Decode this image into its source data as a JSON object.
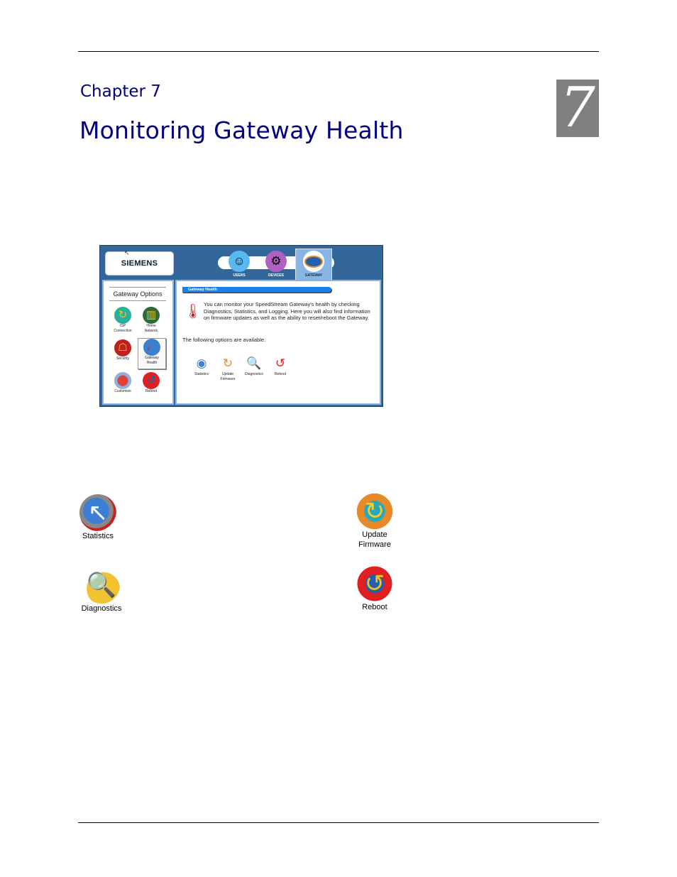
{
  "chapter": {
    "label": "Chapter 7",
    "title": "Monitoring Gateway Health",
    "number": "7"
  },
  "screenshot": {
    "logo": "SIEMENS",
    "nav_tabs": [
      {
        "label": "USERS",
        "icon": "users-icon",
        "active": false
      },
      {
        "label": "DEVICES",
        "icon": "devices-icon",
        "active": false
      },
      {
        "label": "GATEWAY",
        "icon": "gateway-icon",
        "active": true
      }
    ],
    "options_title": "Gateway Options",
    "options": [
      {
        "label_line1": "ISP",
        "label_line2": "Connection",
        "icon": "isp-connection-icon"
      },
      {
        "label_line1": "Home",
        "label_line2": "Network",
        "icon": "home-network-icon"
      },
      {
        "label_line1": "Security",
        "label_line2": "",
        "icon": "security-icon"
      },
      {
        "label_line1": "Gateway",
        "label_line2": "Health",
        "icon": "gateway-health-icon",
        "selected": true
      },
      {
        "label_line1": "Customize",
        "label_line2": "",
        "icon": "customize-icon"
      },
      {
        "label_line1": "Reboot",
        "label_line2": "",
        "icon": "reboot-icon"
      }
    ],
    "section_header": "Gateway Health",
    "description": "You can monitor your SpeedStream Gateway's health by checking Diagnostics, Statistics, and Logging. Here you will also find information on firmware updates as well as the ability to reset/reboot the Gateway.",
    "available_label": "The following options are available:",
    "available_options": [
      {
        "label_line1": "Statistics",
        "label_line2": ""
      },
      {
        "label_line1": "Update",
        "label_line2": "Firmware"
      },
      {
        "label_line1": "Diagnostics",
        "label_line2": ""
      },
      {
        "label_line1": "Reboot",
        "label_line2": ""
      }
    ]
  },
  "features": [
    {
      "label_line1": "Statistics",
      "label_line2": "",
      "icon": "statistics-icon"
    },
    {
      "label_line1": "Update",
      "label_line2": "Firmware",
      "icon": "update-firmware-icon"
    },
    {
      "label_line1": "Diagnostics",
      "label_line2": "",
      "icon": "diagnostics-icon"
    },
    {
      "label_line1": "Reboot",
      "label_line2": "",
      "icon": "reboot-icon"
    }
  ],
  "colors": {
    "heading": "#000080",
    "chapter_box": "#808080",
    "ui_frame": "#336699",
    "ui_panel_border": "#8ab4e4",
    "header_bar": "#1a7fe8"
  }
}
